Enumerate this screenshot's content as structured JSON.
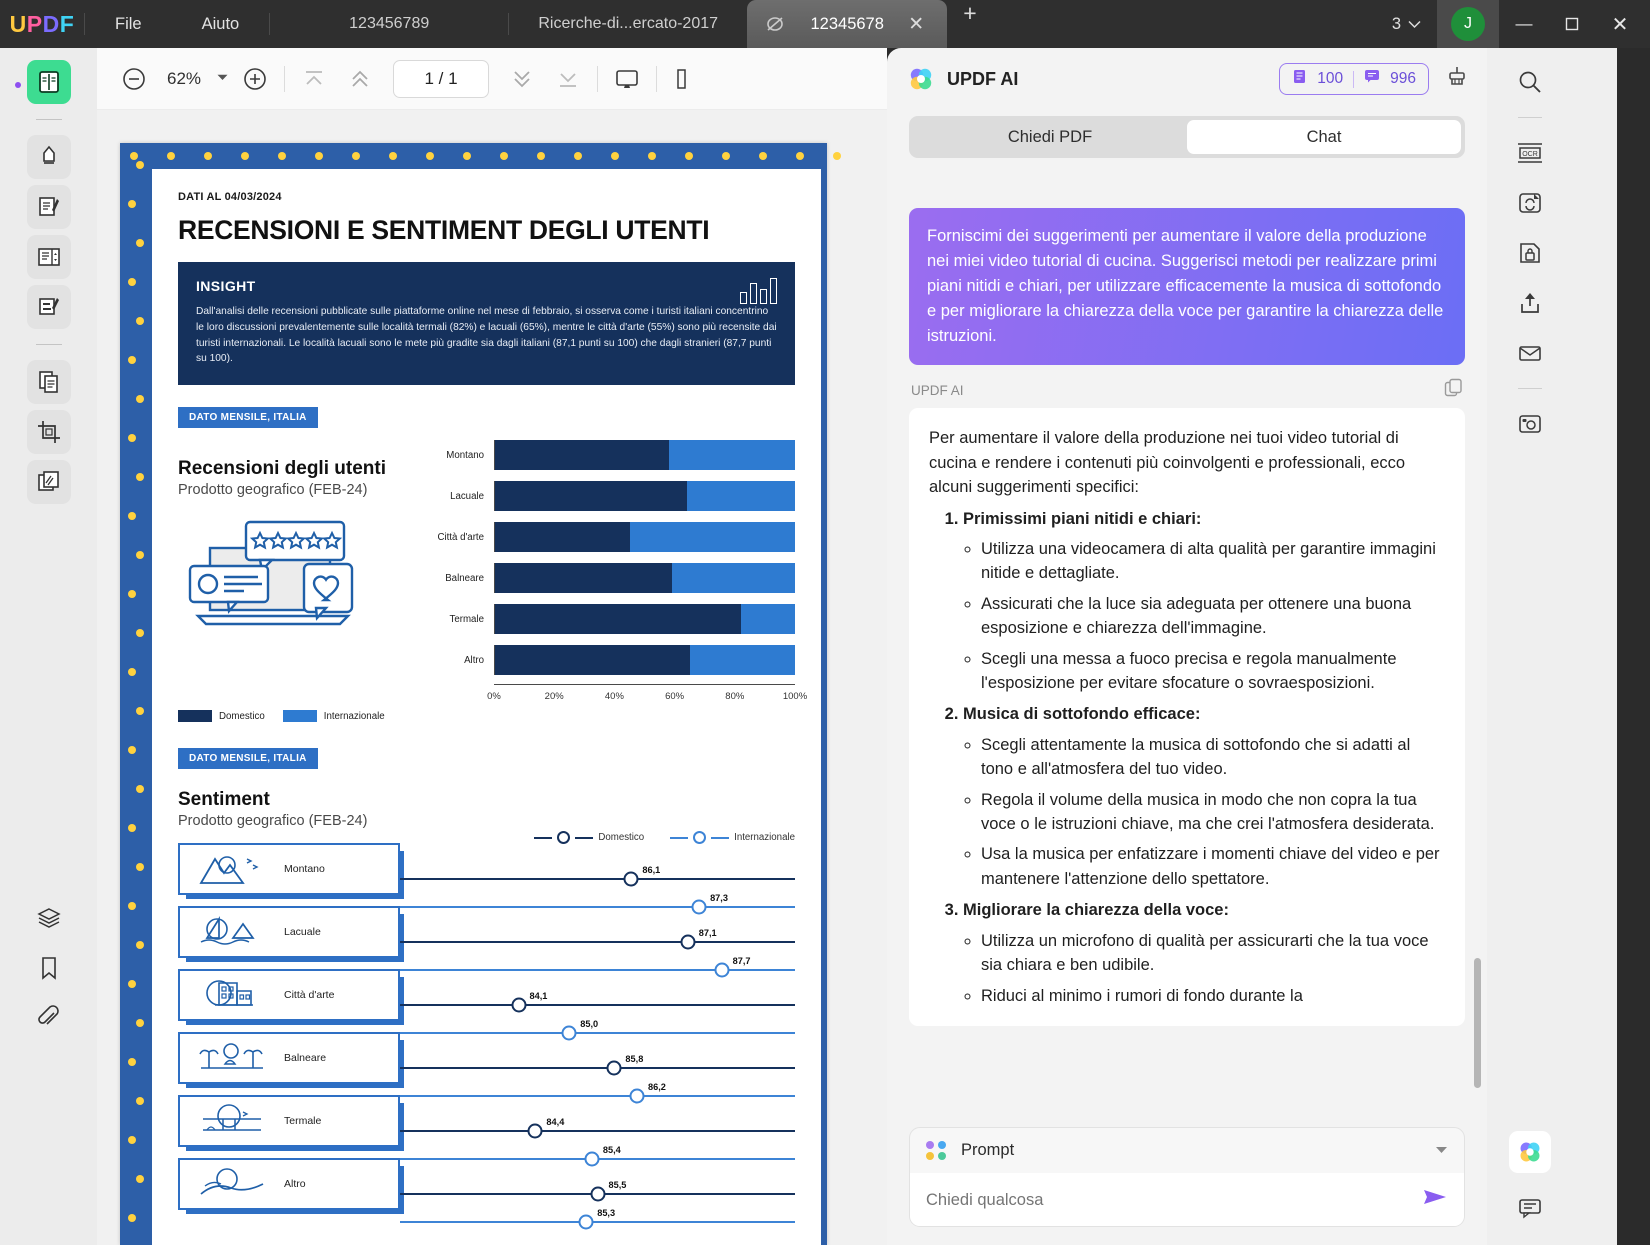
{
  "titlebar": {
    "logo": "UPDF",
    "menus": [
      "File",
      "Aiuto"
    ],
    "tabs": [
      {
        "label": "123456789",
        "active": false
      },
      {
        "label": "Ricerche-di...ercato-2017",
        "active": false
      },
      {
        "label": "12345678",
        "active": true
      }
    ],
    "close_label": "✕",
    "new_tab_label": "+",
    "window_count": "3",
    "avatar_initial": "J",
    "minimize": "—",
    "maximize": "☐",
    "close": "✕"
  },
  "toolbar": {
    "zoom_out": "−",
    "zoom_value": "62%",
    "zoom_in": "+",
    "page_value": "1 / 1",
    "first_page_icon": "first-page-icon",
    "prev_page_icon": "prev-page-icon",
    "next_page_icon": "next-page-icon",
    "last_page_icon": "last-page-icon",
    "present_icon": "present-icon"
  },
  "left_rail": {
    "items": [
      {
        "name": "reader-mode",
        "selected": true
      },
      {
        "name": "highlighter"
      },
      {
        "name": "edit-text"
      },
      {
        "name": "page-layout"
      },
      {
        "name": "annotate"
      },
      {
        "name": "organize-pages"
      },
      {
        "name": "crop-page"
      },
      {
        "name": "batch-pages"
      },
      {
        "name": "layers"
      },
      {
        "name": "bookmark"
      },
      {
        "name": "attachment"
      }
    ]
  },
  "right_rail": {
    "items": [
      "search",
      "ocr",
      "convert",
      "protect",
      "share",
      "email",
      "save-as"
    ],
    "bottom": [
      "updf-ai",
      "comment"
    ]
  },
  "ai_panel": {
    "title": "UPDF AI",
    "chip_pages": "100",
    "chip_messages": "996",
    "brush_icon": "brush-icon",
    "tabs": [
      {
        "label": "Chiedi PDF",
        "active": false
      },
      {
        "label": "Chat",
        "active": true
      }
    ],
    "user_message": "Forniscimi dei suggerimenti per aumentare il valore della produzione nei miei video tutorial di cucina. Suggerisci metodi per realizzare primi piani nitidi e chiari, per utilizzare efficacemente la musica di sottofondo e per migliorare la chiarezza della voce per garantire la chiarezza delle istruzioni.",
    "ai_label": "UPDF AI",
    "copy_icon": "copy-icon",
    "ai_intro": "Per aumentare il valore della produzione nei tuoi video tutorial di cucina e rendere i contenuti più coinvolgenti e professionali, ecco alcuni suggerimenti specifici:",
    "ai_sections": [
      {
        "heading": "Primissimi piani nitidi e chiari",
        "bullets": [
          "Utilizza una videocamera di alta qualità per garantire immagini nitide e dettagliate.",
          "Assicurati che la luce sia adeguata per ottenere una buona esposizione e chiarezza dell'immagine.",
          "Scegli una messa a fuoco precisa e regola manualmente l'esposizione per evitare sfocature o sovraesposizioni."
        ]
      },
      {
        "heading": "Musica di sottofondo efficace",
        "bullets": [
          "Scegli attentamente la musica di sottofondo che si adatti al tono e all'atmosfera del tuo video.",
          "Regola il volume della musica in modo che non copra la tua voce o le istruzioni chiave, ma che crei l'atmosfera desiderata.",
          "Usa la musica per enfatizzare i momenti chiave del video e per mantenere l'attenzione dello spettatore."
        ]
      },
      {
        "heading": "Migliorare la chiarezza della voce",
        "bullets": [
          "Utilizza un microfono di qualità per assicurarti che la tua voce sia chiara e ben udibile.",
          "Riduci al minimo i rumori di fondo durante la"
        ]
      }
    ],
    "composer": {
      "prompt_label": "Prompt",
      "input_placeholder": "Chiedi qualcosa",
      "send_icon": "send-icon",
      "caret_icon": "chevron-down-icon"
    }
  },
  "document": {
    "date_line": "DATI AL 04/03/2024",
    "title": "RECENSIONI E SENTIMENT DEGLI UTENTI",
    "insight": {
      "heading": "INSIGHT",
      "body": "Dall'analisi delle recensioni pubblicate sulle piattaforme online nel mese di febbraio, si osserva come i turisti italiani concentrino le loro discussioni prevalentemente sulle località termali (82%) e lacuali (65%), mentre le città d'arte (55%) sono più recensite dai turisti internazionali. Le località lacuali sono le mete più gradite sia dagli italiani (87,1 punti su 100) che dagli stranieri (87,7 punti su 100)."
    },
    "section1": {
      "tag": "DATO MENSILE, ITALIA",
      "title": "Recensioni degli utenti",
      "subtitle": "Prodotto geografico (FEB-24)"
    },
    "section2": {
      "tag": "DATO MENSILE, ITALIA",
      "title": "Sentiment",
      "subtitle": "Prodotto geografico (FEB-24)"
    }
  },
  "chart_data": [
    {
      "type": "bar",
      "title": "Recensioni degli utenti",
      "subtitle": "Prodotto geografico (FEB-24)",
      "orientation": "horizontal",
      "stacked": true,
      "stack_total_percent": 100,
      "categories": [
        "Montano",
        "Lacuale",
        "Città d'arte",
        "Balneare",
        "Termale",
        "Altro"
      ],
      "series": [
        {
          "name": "Domestico",
          "color": "#15315c",
          "values": [
            58,
            64,
            45,
            59,
            82,
            65
          ]
        },
        {
          "name": "Internazionale",
          "color": "#2e7bd1",
          "values": [
            42,
            36,
            55,
            41,
            18,
            35
          ]
        }
      ],
      "xlabel": "",
      "ylabel": "",
      "xticks": [
        "0%",
        "20%",
        "40%",
        "60%",
        "80%",
        "100%"
      ],
      "xlim": [
        0,
        100
      ],
      "legend_position": "bottom-left",
      "grid": false
    },
    {
      "type": "scatter",
      "title": "Sentiment",
      "subtitle": "Prodotto geografico (FEB-24)",
      "orientation": "horizontal",
      "categories": [
        "Montano",
        "Lacuale",
        "Città d'arte",
        "Balneare",
        "Termale",
        "Altro"
      ],
      "series": [
        {
          "name": "Domestico",
          "color": "#15315c",
          "values": [
            86.1,
            87.1,
            84.1,
            85.8,
            84.4,
            85.5
          ],
          "labels": [
            "86,1",
            "87,1",
            "84,1",
            "85,8",
            "84,4",
            "85,5"
          ]
        },
        {
          "name": "Internazionale",
          "color": "#3d84d6",
          "values": [
            87.3,
            87.7,
            85.0,
            86.2,
            85.4,
            85.3
          ],
          "labels": [
            "87,3",
            "87,7",
            "85,0",
            "86,2",
            "85,4",
            "85,3"
          ]
        }
      ],
      "value_scale_min": 82.0,
      "value_scale_max": 89.0,
      "legend_position": "top-right",
      "grid": false
    }
  ]
}
